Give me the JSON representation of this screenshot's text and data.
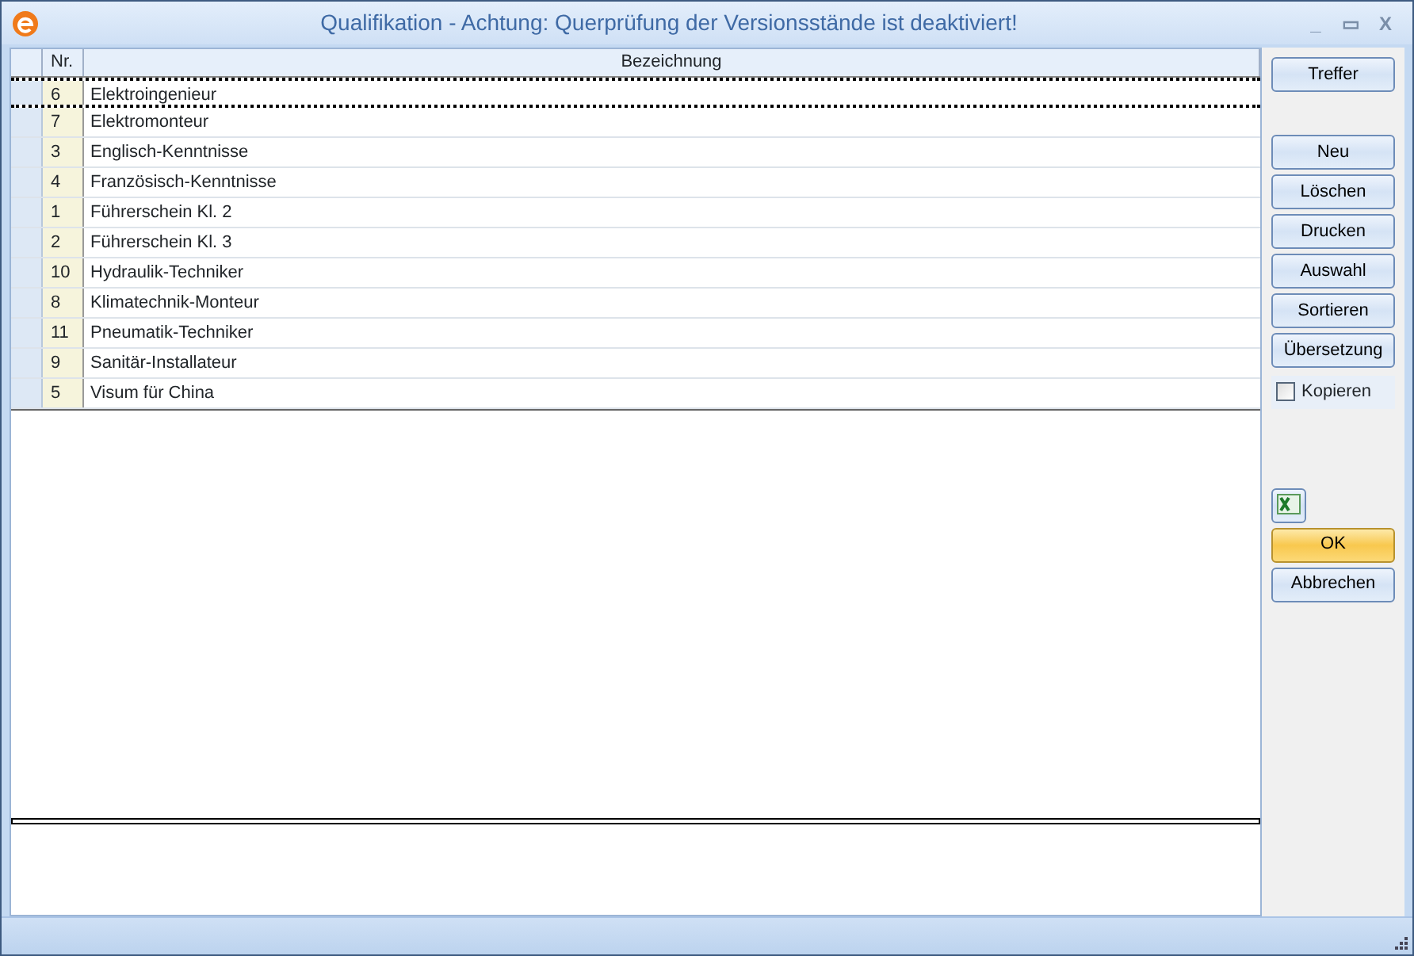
{
  "window": {
    "title": "Qualifikation - Achtung: Querprüfung der Versionsstände ist deaktiviert!",
    "controls": [
      "_",
      "▭",
      "X"
    ]
  },
  "table": {
    "columns": [
      "Nr.",
      "Bezeichnung"
    ],
    "rows": [
      {
        "nr": "6",
        "name": "Elektroingenieur",
        "selected": true
      },
      {
        "nr": "7",
        "name": "Elektromonteur",
        "selected": false
      },
      {
        "nr": "3",
        "name": "Englisch-Kenntnisse",
        "selected": false
      },
      {
        "nr": "4",
        "name": "Französisch-Kenntnisse",
        "selected": false
      },
      {
        "nr": "1",
        "name": "Führerschein Kl. 2",
        "selected": false
      },
      {
        "nr": "2",
        "name": "Führerschein Kl. 3",
        "selected": false
      },
      {
        "nr": "10",
        "name": "Hydraulik-Techniker",
        "selected": false
      },
      {
        "nr": "8",
        "name": "Klimatechnik-Monteur",
        "selected": false
      },
      {
        "nr": "11",
        "name": "Pneumatik-Techniker",
        "selected": false
      },
      {
        "nr": "9",
        "name": "Sanitär-Installateur",
        "selected": false
      },
      {
        "nr": "5",
        "name": "Visum für China",
        "selected": false
      }
    ]
  },
  "side": {
    "top_button": "Treffer",
    "buttons": [
      "Neu",
      "Löschen",
      "Drucken",
      "Auswahl",
      "Sortieren",
      "Übersetzung"
    ],
    "copy": {
      "label": "Kopieren",
      "checked": false
    },
    "actions": [
      {
        "label": "OK",
        "kind": "default"
      },
      {
        "label": "Abbrechen",
        "kind": "normal"
      }
    ]
  }
}
